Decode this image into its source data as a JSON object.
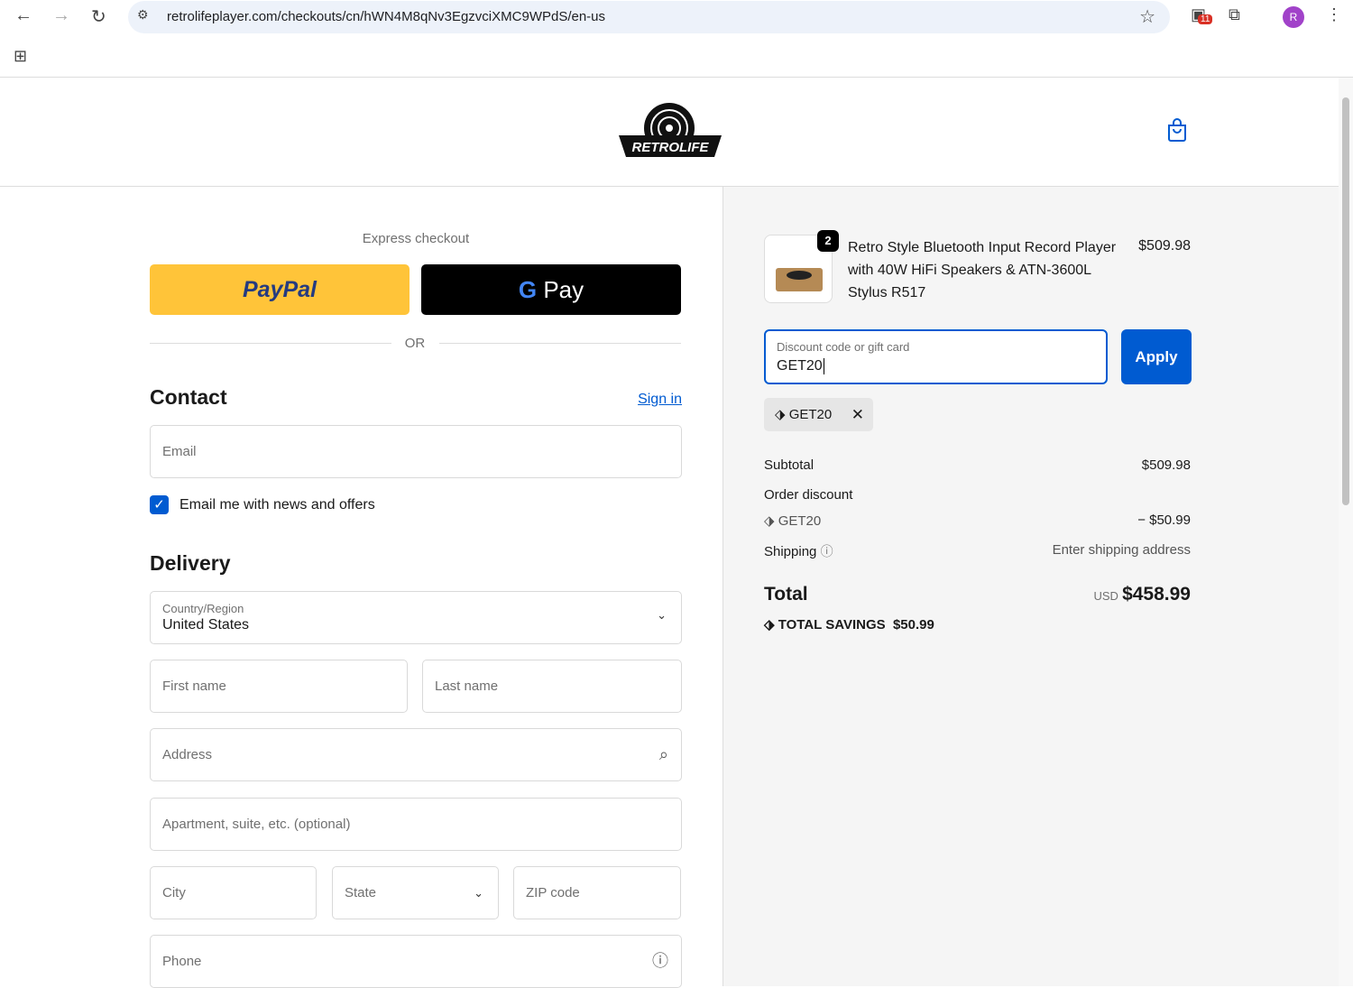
{
  "browser": {
    "url": "retrolifeplayer.com/checkouts/cn/hWN4M8qNv3EgzvciXMC9WPdS/en-us",
    "ext_badge": "11",
    "profile": "R"
  },
  "brand": {
    "logo_text": "RETROLIFE"
  },
  "express": {
    "label": "Express checkout",
    "paypal": "PayPal",
    "gpay": "Pay",
    "or": "OR"
  },
  "contact": {
    "title": "Contact",
    "sign_in": "Sign in",
    "email_placeholder": "Email",
    "newsletter": "Email me with news and offers",
    "newsletter_checked": true
  },
  "delivery": {
    "title": "Delivery",
    "country_label": "Country/Region",
    "country": "United States",
    "first_name": "First name",
    "last_name": "Last name",
    "address": "Address",
    "apartment": "Apartment, suite, etc. (optional)",
    "city": "City",
    "state": "State",
    "zip": "ZIP code",
    "phone": "Phone"
  },
  "summary": {
    "item": {
      "qty": "2",
      "name": "Retro Style Bluetooth Input Record Player with 40W HiFi Speakers & ATN-3600L Stylus R517",
      "price": "$509.98"
    },
    "discount": {
      "label": "Discount code or gift card",
      "value": "GET20",
      "apply": "Apply",
      "tag": "GET20"
    },
    "subtotal_label": "Subtotal",
    "subtotal": "$509.98",
    "order_discount_label": "Order discount",
    "discount_code": "GET20",
    "discount_amount": "− $50.99",
    "shipping_label": "Shipping",
    "shipping_value": "Enter shipping address",
    "total_label": "Total",
    "currency": "USD",
    "total": "$458.99",
    "savings_label": "TOTAL SAVINGS",
    "savings": "$50.99"
  },
  "colors": {
    "accent": "#005bd1",
    "paypal": "#ffc439"
  }
}
